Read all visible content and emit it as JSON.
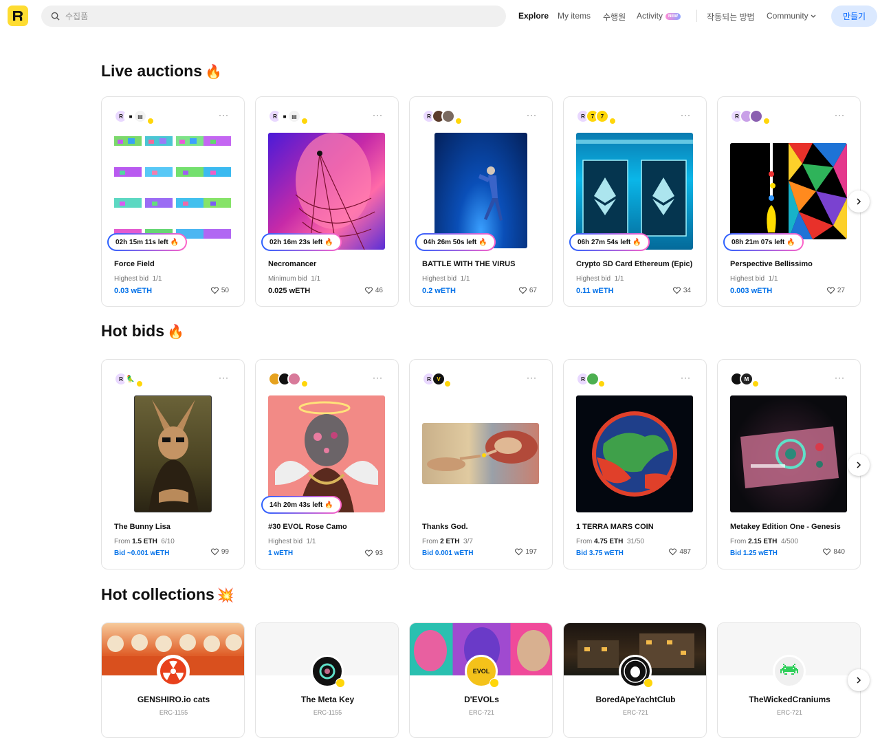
{
  "header": {
    "search_placeholder": "수집품",
    "nav": {
      "explore": "Explore",
      "my_items": "My items",
      "following": "수행원",
      "activity": "Activity",
      "activity_badge": "NEW",
      "how_it_works": "작동되는 방법",
      "community": "Community"
    },
    "create_button": "만들기"
  },
  "live_auctions": {
    "title": "Live auctions",
    "emoji": "🔥",
    "cards": [
      {
        "timer": "02h 15m  11s  left 🔥",
        "title": "Force Field",
        "bid_label": "Highest bid",
        "edition": "1/1",
        "price": "0.03 wETH",
        "likes": "50"
      },
      {
        "timer": "02h 16m  23s  left 🔥",
        "title": "Necromancer",
        "bid_label": "Minimum bid",
        "edition": "1/1",
        "price": "0.025 wETH",
        "likes": "46"
      },
      {
        "timer": "04h 26m  50s  left 🔥",
        "title": "BATTLE WITH THE VIRUS",
        "bid_label": "Highest bid",
        "edition": "1/1",
        "price": "0.2 wETH",
        "likes": "67"
      },
      {
        "timer": "06h 27m  54s  left 🔥",
        "title": "Crypto SD Card Ethereum (Epic)",
        "bid_label": "Highest bid",
        "edition": "1/1",
        "price": "0.11 wETH",
        "likes": "34"
      },
      {
        "timer": "08h 21m  07s  left 🔥",
        "title": "Perspective Bellissimo",
        "bid_label": "Highest bid",
        "edition": "1/1",
        "price": "0.003 wETH",
        "likes": "27"
      }
    ]
  },
  "hot_bids": {
    "title": "Hot bids",
    "emoji": "🔥",
    "cards": [
      {
        "title": "The Bunny Lisa",
        "from_label": "From",
        "from_price": "1.5 ETH",
        "edition": "6/10",
        "price": "Bid ~0.001 wETH",
        "likes": "99"
      },
      {
        "timer": "14h 20m  43s  left 🔥",
        "title": "#30 EVOL Rose Camo",
        "bid_label": "Highest bid",
        "edition": "1/1",
        "price": "1 wETH",
        "likes": "93"
      },
      {
        "title": "Thanks God.",
        "from_label": "From",
        "from_price": "2 ETH",
        "edition": "3/7",
        "price": "Bid 0.001 wETH",
        "likes": "197"
      },
      {
        "title": "1 TERRA MARS COIN",
        "from_label": "From",
        "from_price": "4.75 ETH",
        "edition": "31/50",
        "price": "Bid 3.75 wETH",
        "likes": "487"
      },
      {
        "title": "Metakey Edition One - Genesis",
        "from_label": "From",
        "from_price": "2.15 ETH",
        "edition": "4/500",
        "price": "Bid 1.25 wETH",
        "likes": "840"
      }
    ]
  },
  "hot_collections": {
    "title": "Hot collections",
    "emoji": "💥",
    "items": [
      {
        "name": "GENSHIRO.io cats",
        "type": "ERC-1155"
      },
      {
        "name": "The Meta Key",
        "type": "ERC-1155"
      },
      {
        "name": "D'EVOLs",
        "type": "ERC-721"
      },
      {
        "name": "BoredApeYachtClub",
        "type": "ERC-721"
      },
      {
        "name": "TheWickedCraniums",
        "type": "ERC-721"
      }
    ]
  },
  "colors": {
    "brand_yellow": "#fedc31",
    "price_blue": "#0070e8",
    "create_bg": "#dbe9ff"
  }
}
